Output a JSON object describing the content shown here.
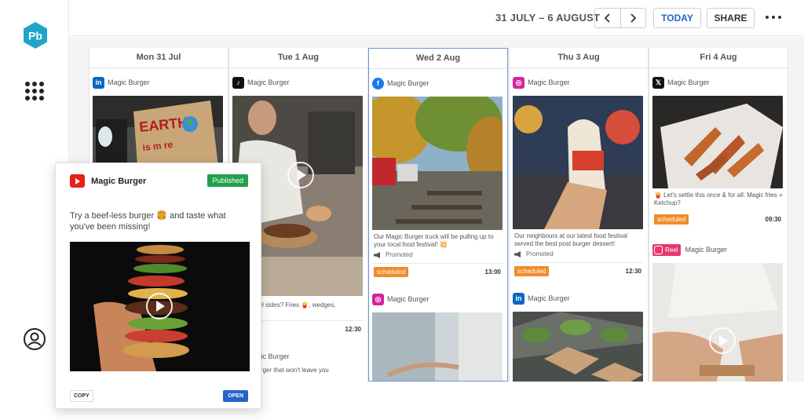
{
  "app": {
    "logo_text": "Pb"
  },
  "header": {
    "date_range": "31 JULY – 6 AUGUST",
    "today_label": "TODAY",
    "share_label": "SHARE"
  },
  "days": [
    {
      "label": "Mon 31 Jul"
    },
    {
      "label": "Tue 1 Aug"
    },
    {
      "label": "Wed 2 Aug",
      "selected": true
    },
    {
      "label": "Thu 3 Aug"
    },
    {
      "label": "Fri 4 Aug"
    }
  ],
  "posts": {
    "mon_1": {
      "network": "linkedin-icon",
      "account": "Magic Burger"
    },
    "tue_1": {
      "network": "tiktok-icon",
      "account": "Magic Burger",
      "caption": "Superbowl sides? Fries 🍟, wedges,",
      "status": "ed",
      "time": "12:30"
    },
    "tue_2": {
      "account": "Magic Burger",
      "caption": "g for a burger that won't leave you"
    },
    "wed_1": {
      "network": "facebook-icon",
      "account": "Magic Burger",
      "caption": "Our Magic Burger truck will be pulling up to your local food festival! 💥",
      "promoted": "Promoted",
      "status": "scheduled",
      "time": "13:00"
    },
    "wed_2": {
      "network": "instagram-icon",
      "account": "Magic Burger"
    },
    "thu_1": {
      "network": "instagram-icon",
      "account": "Magic Burger",
      "caption": "Our neighbours at our latest food festival served the best post burger dessert!",
      "promoted": "Promoted",
      "status": "scheduled",
      "time": "12:30"
    },
    "thu_2": {
      "network": "linkedin-icon",
      "account": "Magic Burger"
    },
    "fri_1": {
      "network": "x-icon",
      "account": "Magic Burger",
      "caption": "🍟 Let's settle this once & for all: Magic fries + Ketchup?",
      "status": "scheduled",
      "time": "09:30"
    },
    "fri_2": {
      "chip": "Reel",
      "account": "Magic Burger"
    }
  },
  "preview": {
    "network": "youtube-icon",
    "account": "Magic Burger",
    "status": "Published",
    "text": "Try a beef-less burger 🍔 and taste what you've been missing!",
    "copy_label": "COPY",
    "open_label": "OPEN"
  },
  "colors": {
    "accent": "#2563c9",
    "published": "#22a04a",
    "scheduled": "#f08c2b",
    "logo": "#1fa3c9"
  }
}
